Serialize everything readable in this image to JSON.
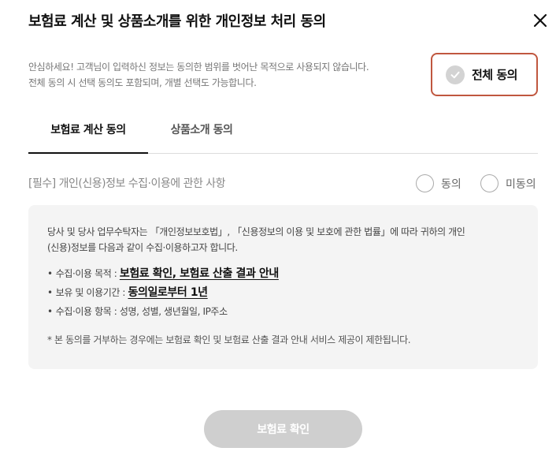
{
  "dialog": {
    "title": "보험료 계산 및 상품소개를 위한 개인정보 처리 동의",
    "close_icon": "close-icon"
  },
  "notice": {
    "line1": "안심하세요! 고객님이 입력하신 정보는 동의한 범위를 벗어난 목적으로 사용되지 않습니다.",
    "line2": "전체 동의 시 선택 동의도 포함되며, 개별 선택도 가능합니다."
  },
  "agree_all": {
    "label": "전체 동의",
    "icon": "check-icon",
    "border_color": "#c0573f"
  },
  "tabs": [
    {
      "label": "보험료 계산 동의",
      "active": true
    },
    {
      "label": "상품소개 동의",
      "active": false
    }
  ],
  "section": {
    "title": "[필수] 개인(신용)정보 수집·이용에 관한 사항",
    "radio_agree": "동의",
    "radio_disagree": "미동의"
  },
  "content": {
    "intro_line1": "당사 및 당사 업무수탁자는 「개인정보보호법」, 「신용정보의 이용 및 보호에 관한 법률」에 따라 귀하의 개인",
    "intro_line2": "(신용)정보를 다음과 같이 수집·이용하고자 합니다.",
    "bullets": [
      {
        "label": "수집·이용 목적 : ",
        "value": "보험료 확인, 보험료 산출 결과 안내"
      },
      {
        "label": "보유 및 이용기간 : ",
        "value": "동의일로부터 1년"
      },
      {
        "label": "수집·이용 항목 : ",
        "value": "성명, 성별, 생년월일, IP주소"
      }
    ],
    "footnote": "* 본 동의를 거부하는 경우에는 보험료 확인 및 보험료 산출 결과 안내 서비스 제공이 제한됩니다."
  },
  "confirm_button": {
    "label": "보험료 확인"
  }
}
